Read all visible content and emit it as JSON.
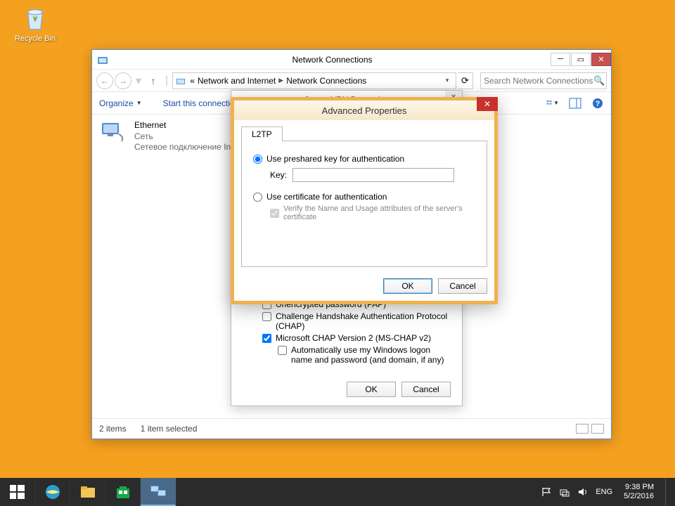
{
  "desktop": {
    "recycle_bin_label": "Recycle Bin"
  },
  "window": {
    "title": "Network Connections",
    "breadcrumb": {
      "prefix": "«",
      "part1": "Network and Internet",
      "part2": "Network Connections"
    },
    "search_placeholder": "Search Network Connections",
    "toolbar": {
      "organize": "Organize",
      "start_connection": "Start this connection"
    },
    "ethernet": {
      "title": "Ethernet",
      "line2": "Сеть",
      "line3": "Сетевое подключение Intel..."
    },
    "status": {
      "items": "2 items",
      "selected": "1 item selected"
    }
  },
  "vpn_dialog": {
    "title": "SecureVPN Properties",
    "pap": "Unencrypted password (PAP)",
    "chap": "Challenge Handshake Authentication Protocol (CHAP)",
    "mschap": "Microsoft CHAP Version 2 (MS-CHAP v2)",
    "autologon": "Automatically use my Windows logon name and password (and domain, if any)",
    "ok": "OK",
    "cancel": "Cancel"
  },
  "adv_dialog": {
    "title": "Advanced Properties",
    "tab": "L2TP",
    "radio_psk": "Use preshared key for authentication",
    "key_label": "Key:",
    "key_value": "",
    "radio_cert": "Use certificate for authentication",
    "verify_cert": "Verify the Name and Usage attributes of the server's certificate",
    "ok": "OK",
    "cancel": "Cancel"
  },
  "taskbar": {
    "lang": "ENG",
    "time": "9:38 PM",
    "date": "5/2/2016"
  }
}
